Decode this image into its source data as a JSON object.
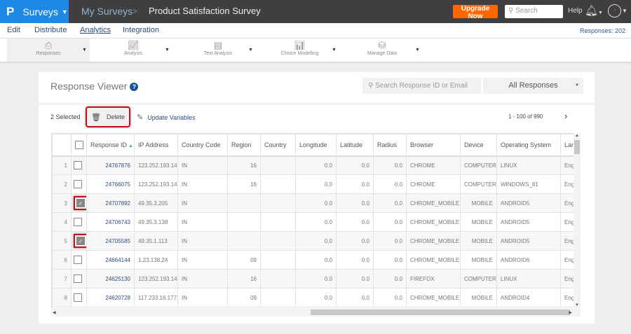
{
  "header": {
    "logo": "P",
    "product": "Surveys",
    "breadcrumb": "My Surveys",
    "separator": ">",
    "survey_title": "Product Satisfaction Survey",
    "upgrade": "Upgrade Now",
    "search_placeholder": "Search",
    "help": "Help"
  },
  "nav": {
    "items": [
      "Edit",
      "Distribute",
      "Analytics",
      "Integration"
    ],
    "active": "Analytics",
    "responses_count": "Responses: 202"
  },
  "tools": [
    {
      "label": "Responses",
      "icon": "responses-icon"
    },
    {
      "label": "Analysis",
      "icon": "chart-icon"
    },
    {
      "label": "Text Analysis",
      "icon": "text-analysis-icon"
    },
    {
      "label": "Choice Modelling",
      "icon": "choice-icon"
    },
    {
      "label": "Manage Data",
      "icon": "database-icon"
    }
  ],
  "viewer": {
    "title": "Response Viewer",
    "help_icon": "?",
    "search_placeholder": "Search Response ID or Email",
    "filter": "All Responses",
    "selected": "2 Selected",
    "delete": "Delete",
    "update": "Update Variables",
    "pagination": "1 - 100 of 990"
  },
  "colors": {
    "brand": "#1e88e5",
    "upgrade": "#ff6600",
    "highlight": "#c0121c"
  },
  "table": {
    "columns": [
      "Response ID",
      "IP Address",
      "Country Code",
      "Region",
      "Country",
      "Longitude",
      "Latitude",
      "Radius",
      "Browser",
      "Device",
      "Operating System",
      "Lan"
    ],
    "sort": "Response ID ascending",
    "rows": [
      {
        "n": "1",
        "checked": false,
        "cells": [
          "24767876",
          "123.252.193.148",
          "IN",
          "16",
          "",
          "0.0",
          "0.0",
          "0.0",
          "CHROME",
          "COMPUTER",
          "LINUX",
          "Eng"
        ]
      },
      {
        "n": "2",
        "checked": false,
        "cells": [
          "24766075",
          "123.252.193.148",
          "IN",
          "16",
          "",
          "0.0",
          "0.0",
          "0.0",
          "CHROME",
          "COMPUTER",
          "WINDOWS_81",
          "Eng"
        ]
      },
      {
        "n": "3",
        "checked": true,
        "cells": [
          "24707892",
          "49.35.3.205",
          "IN",
          "",
          "",
          "0.0",
          "0.0",
          "0.0",
          "CHROME_MOBILE",
          "MOBILE",
          "ANDROID5",
          "Eng"
        ]
      },
      {
        "n": "4",
        "checked": false,
        "cells": [
          "24706743",
          "49.35.3.138",
          "IN",
          "",
          "",
          "0.0",
          "0.0",
          "0.0",
          "CHROME_MOBILE",
          "MOBILE",
          "ANDROID5",
          "Eng"
        ]
      },
      {
        "n": "5",
        "checked": true,
        "cells": [
          "24705585",
          "49.35.1.113",
          "IN",
          "",
          "",
          "0.0",
          "0.0",
          "0.0",
          "CHROME_MOBILE",
          "MOBILE",
          "ANDROID5",
          "Eng"
        ]
      },
      {
        "n": "6",
        "checked": false,
        "cells": [
          "24664144",
          "1.23.138.24",
          "IN",
          "09",
          "",
          "0.0",
          "0.0",
          "0.0",
          "CHROME_MOBILE",
          "MOBILE",
          "ANDROID6",
          "Eng"
        ]
      },
      {
        "n": "7",
        "checked": false,
        "cells": [
          "24625130",
          "123.252.193.148",
          "IN",
          "16",
          "",
          "0.0",
          "0.0",
          "0.0",
          "FIREFOX",
          "COMPUTER",
          "LINUX",
          "Eng"
        ]
      },
      {
        "n": "8",
        "checked": false,
        "cells": [
          "24620728",
          "117.233.16.177",
          "IN",
          "09",
          "",
          "0.0",
          "0.0",
          "0.0",
          "CHROME_MOBILE",
          "MOBILE",
          "ANDROID4",
          "Eng"
        ]
      }
    ]
  }
}
